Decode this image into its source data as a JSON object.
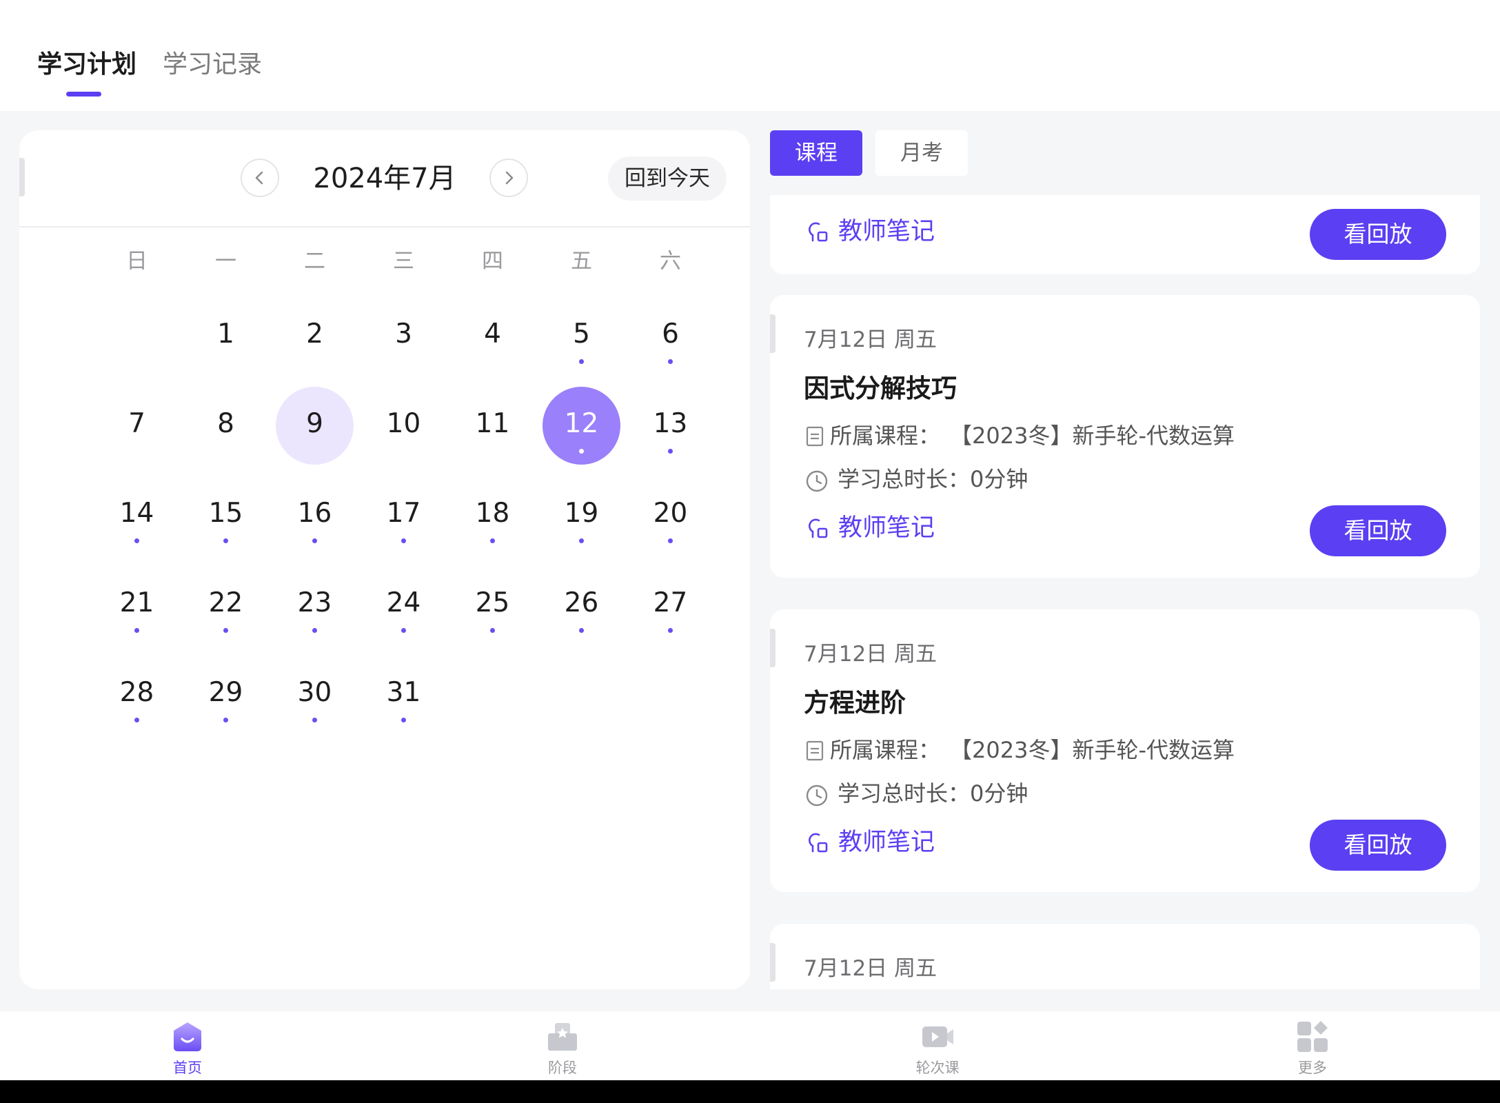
{
  "header": {
    "tabs": [
      {
        "label": "学习计划",
        "active": true
      },
      {
        "label": "学习记录",
        "active": false
      }
    ]
  },
  "calendar": {
    "month_title": "2024年7月",
    "today_button": "回到今天",
    "weekdays": [
      "日",
      "一",
      "二",
      "三",
      "四",
      "五",
      "六"
    ],
    "selected_day": 9,
    "today": 12,
    "days_with_dots": [
      5,
      6,
      12,
      13,
      14,
      15,
      16,
      17,
      18,
      19,
      20,
      21,
      22,
      23,
      24,
      25,
      26,
      27,
      28,
      29,
      30,
      31
    ],
    "first_weekday": 1,
    "days_in_month": 31
  },
  "segments": [
    {
      "label": "课程",
      "active": true
    },
    {
      "label": "月考",
      "active": false
    }
  ],
  "cards": [
    {
      "partial": true,
      "note_label": "教师笔记",
      "replay_label": "看回放"
    },
    {
      "date": "7月12日 周五",
      "title": "因式分解技巧",
      "course_label": "所属课程：",
      "course_value": "【2023冬】新手轮-代数运算",
      "duration": "学习总时长：0分钟",
      "note_label": "教师笔记",
      "replay_label": "看回放"
    },
    {
      "date": "7月12日 周五",
      "title": "方程进阶",
      "course_label": "所属课程：",
      "course_value": "【2023冬】新手轮-代数运算",
      "duration": "学习总时长：0分钟",
      "note_label": "教师笔记",
      "replay_label": "看回放"
    },
    {
      "date": "7月12日 周五",
      "partial": true
    }
  ],
  "bottom_nav": [
    {
      "label": "首页",
      "icon": "home-icon",
      "active": true
    },
    {
      "label": "阶段",
      "icon": "stage-icon",
      "active": false
    },
    {
      "label": "轮次课",
      "icon": "video-icon",
      "active": false
    },
    {
      "label": "更多",
      "icon": "more-grid-icon",
      "active": false
    }
  ],
  "colors": {
    "accent": "#5b3ff2",
    "today_fill": "#9a80fa",
    "selected_fill": "#ebe6fd",
    "background": "#f5f6f8"
  }
}
